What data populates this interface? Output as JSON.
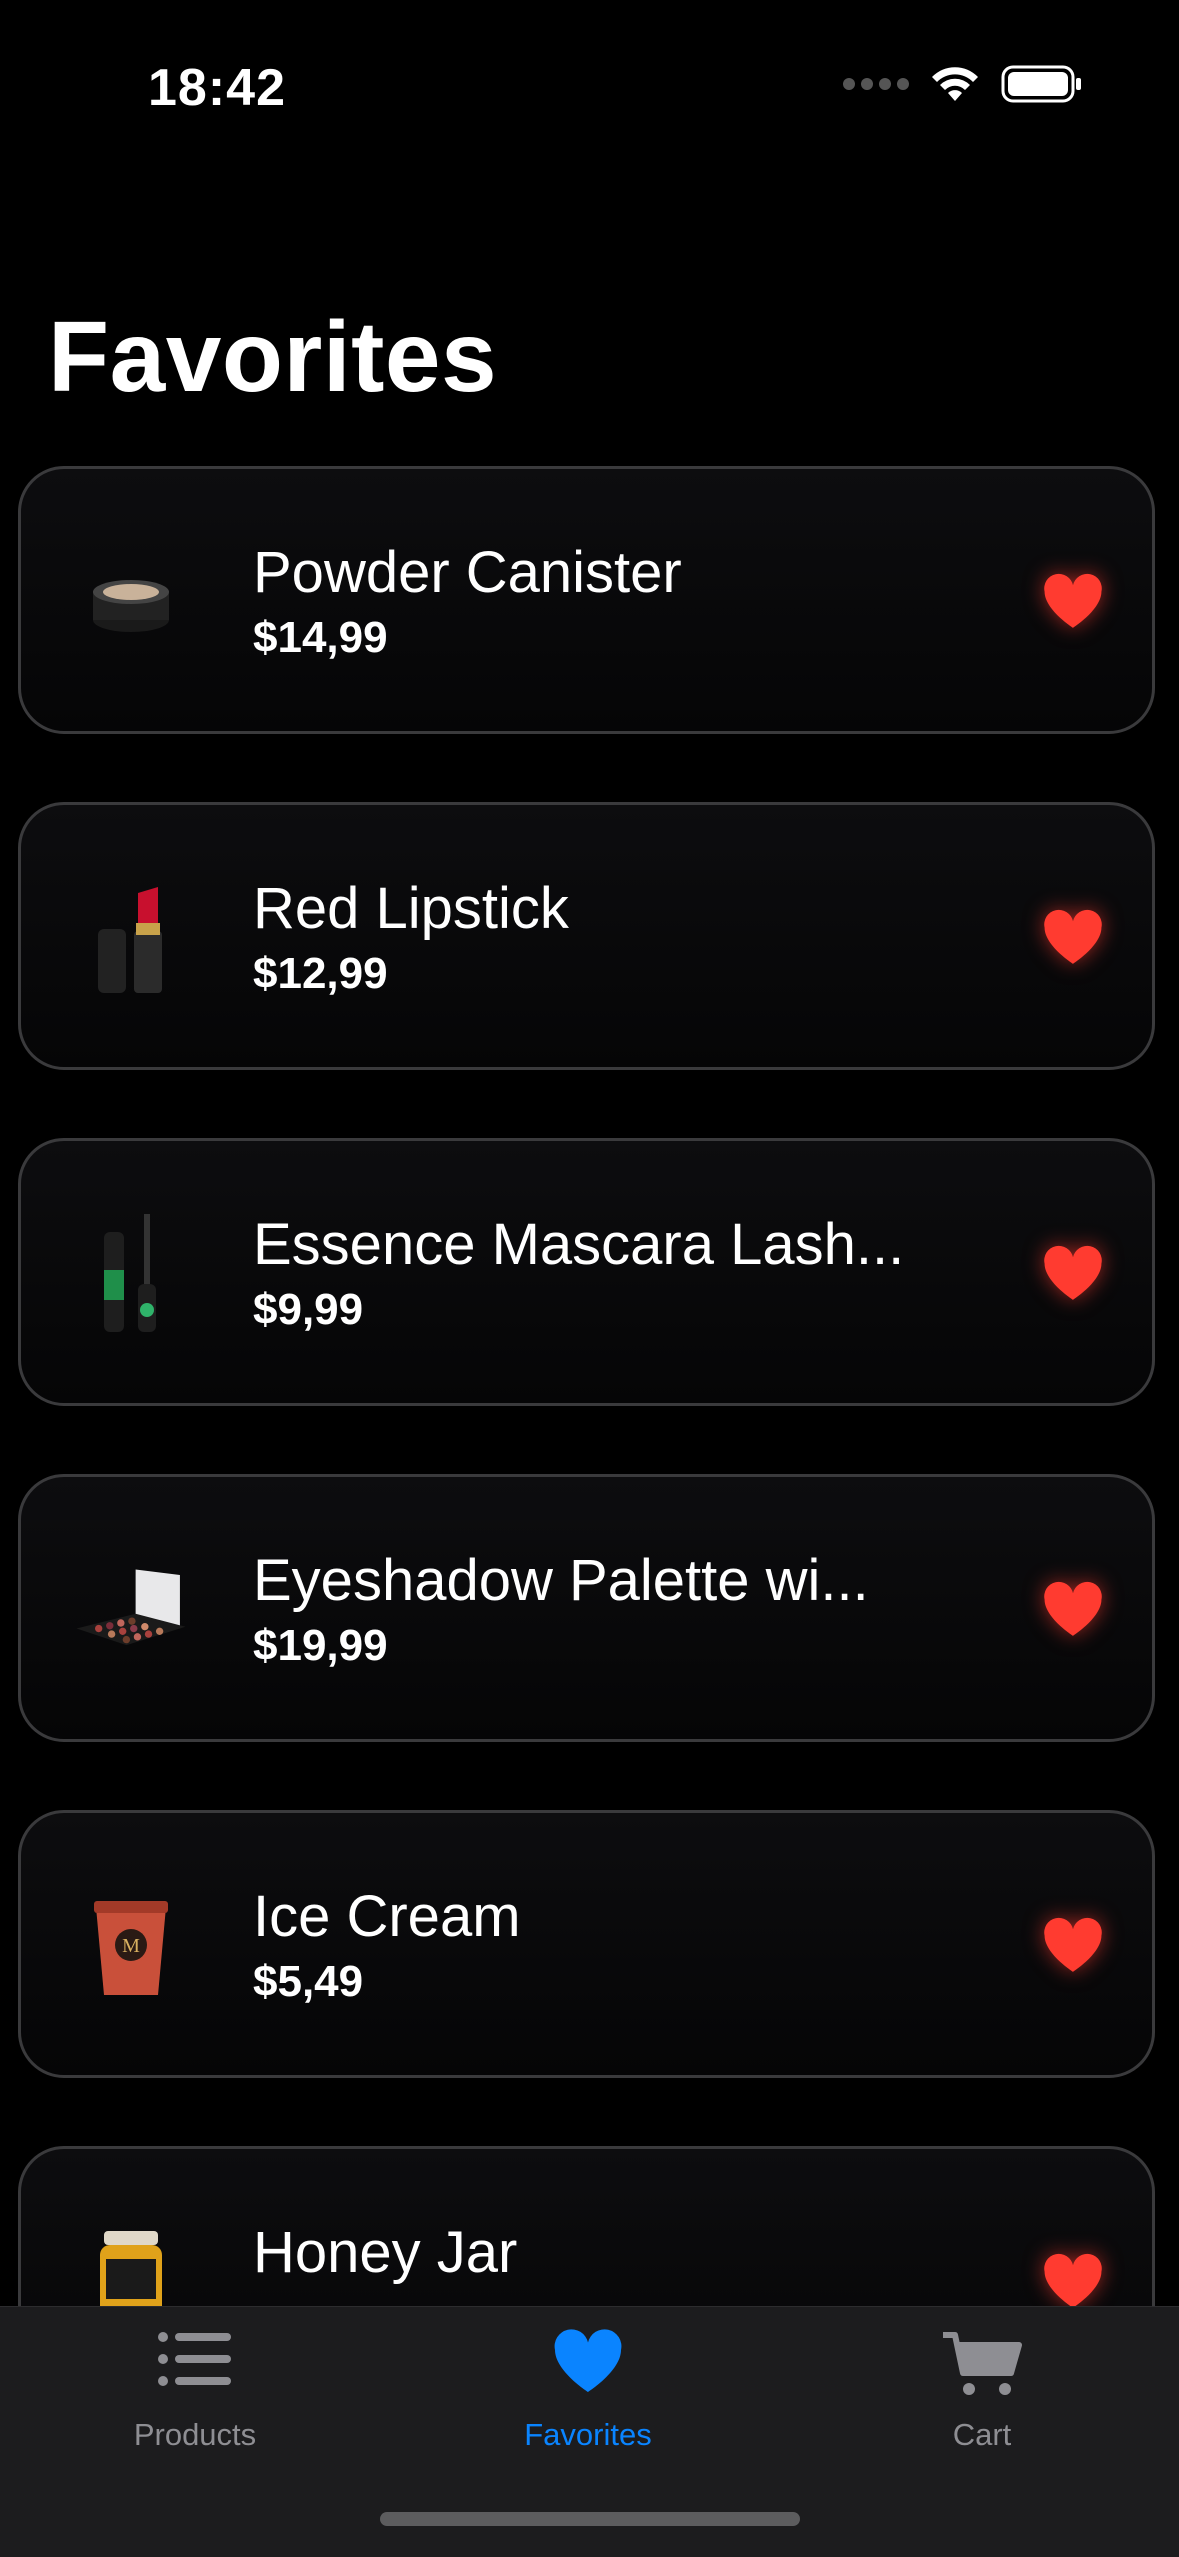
{
  "status_bar": {
    "time": "18:42"
  },
  "page": {
    "title": "Favorites"
  },
  "favorites": [
    {
      "name": "Powder Canister",
      "price": "$14,99",
      "thumb_icon": "powder-canister-thumb-icon",
      "favorited": true
    },
    {
      "name": "Red Lipstick",
      "price": "$12,99",
      "thumb_icon": "lipstick-thumb-icon",
      "favorited": true
    },
    {
      "name": "Essence Mascara Lash...",
      "price": "$9,99",
      "thumb_icon": "mascara-thumb-icon",
      "favorited": true
    },
    {
      "name": "Eyeshadow Palette wi...",
      "price": "$19,99",
      "thumb_icon": "eyeshadow-palette-thumb-icon",
      "favorited": true
    },
    {
      "name": "Ice Cream",
      "price": "$5,49",
      "thumb_icon": "ice-cream-thumb-icon",
      "favorited": true
    },
    {
      "name": "Honey Jar",
      "price": "",
      "thumb_icon": "honey-jar-thumb-icon",
      "favorited": true
    }
  ],
  "tab_bar": {
    "tabs": [
      {
        "label": "Products",
        "icon": "list-icon",
        "active": false
      },
      {
        "label": "Favorites",
        "icon": "heart-icon",
        "active": true
      },
      {
        "label": "Cart",
        "icon": "cart-icon",
        "active": false
      }
    ]
  },
  "colors": {
    "background": "#000000",
    "accent": "#0a84ff",
    "favorite": "#ff3b30",
    "inactive_tab": "#8e8e93",
    "card_border": "#3a3a3c"
  }
}
